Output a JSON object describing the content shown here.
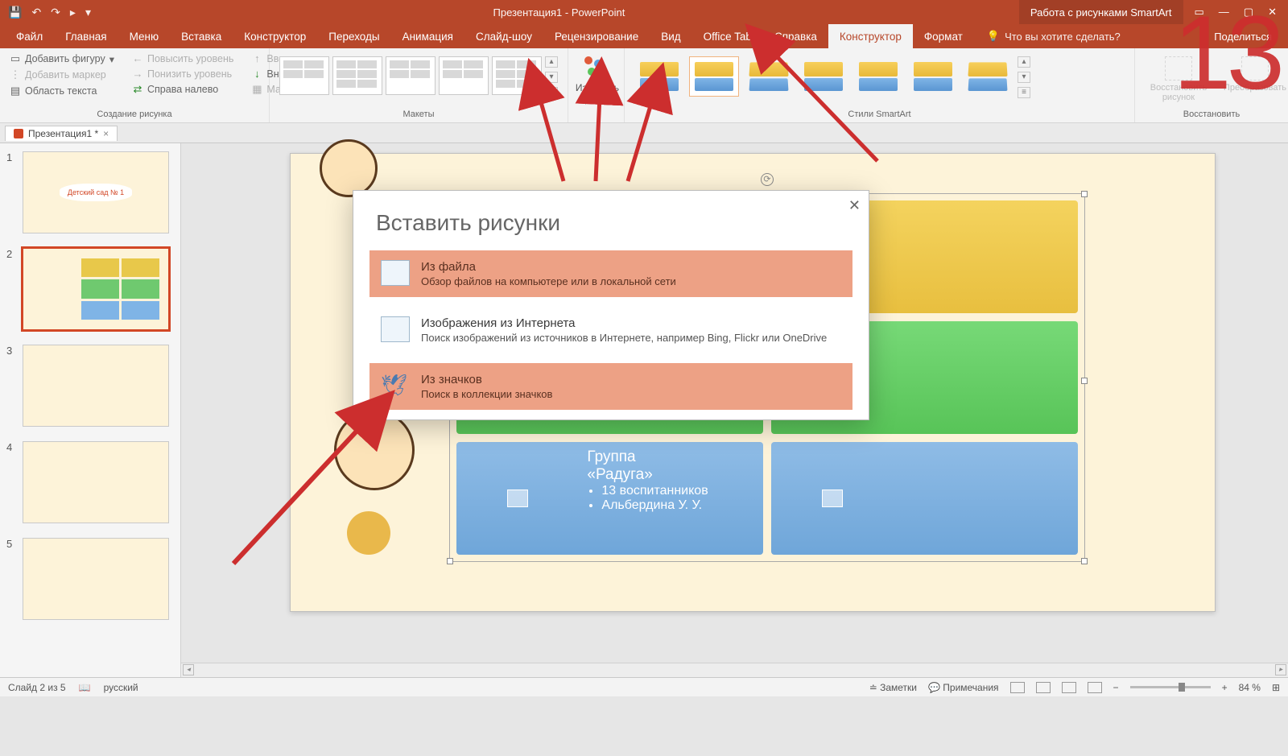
{
  "titlebar": {
    "app_title": "Презентация1 - PowerPoint",
    "context_tab": "Работа с рисунками SmartArt"
  },
  "ribbon_tabs": {
    "file": "Файл",
    "home": "Главная",
    "menu": "Меню",
    "insert": "Вставка",
    "design": "Конструктор",
    "transitions": "Переходы",
    "animations": "Анимация",
    "slideshow": "Слайд-шоу",
    "review": "Рецензирование",
    "view": "Вид",
    "officetab": "Office Tab",
    "help": "Справка",
    "smartart_design": "Конструктор",
    "format": "Формат",
    "tellme": "Что вы хотите сделать?",
    "share": "Поделиться"
  },
  "ribbon": {
    "create_graphic": {
      "add_shape": "Добавить фигуру",
      "add_bullet": "Добавить маркер",
      "text_pane": "Область текста",
      "promote": "Повысить уровень",
      "demote": "Понизить уровень",
      "rtl": "Справа налево",
      "up": "Вверх",
      "down": "Вниз",
      "layout_menu": "Макет",
      "group_label": "Создание рисунка"
    },
    "layouts": {
      "group_label": "Макеты"
    },
    "change_colors": "Изменить цвета",
    "styles": {
      "group_label": "Стили SmartArt"
    },
    "reset": {
      "reset_graphic": "Восстановить рисунок",
      "convert": "Преобразовать",
      "group_label": "Восстановить"
    }
  },
  "doc_tab": {
    "name": "Презентация1 *"
  },
  "annotation_number": "13",
  "thumb_title": "Детский сад № 1",
  "smartart": {
    "cell3": {
      "title": "Группа",
      "subtitle": "«Радуга»",
      "bullet1": "13 воспитанников",
      "bullet2": "Альбердина У. У."
    }
  },
  "dialog": {
    "title": "Вставить рисунки",
    "opt1": {
      "title": "Из файла",
      "desc": "Обзор файлов на компьютере или в локальной сети"
    },
    "opt2": {
      "title": "Изображения из Интернета",
      "desc": "Поиск изображений из источников в Интернете, например Bing, Flickr или OneDrive"
    },
    "opt3": {
      "title": "Из значков",
      "desc": "Поиск в коллекции значков"
    }
  },
  "statusbar": {
    "slide_info": "Слайд 2 из 5",
    "language": "русский",
    "notes": "Заметки",
    "comments": "Примечания",
    "zoom": "84 %"
  }
}
